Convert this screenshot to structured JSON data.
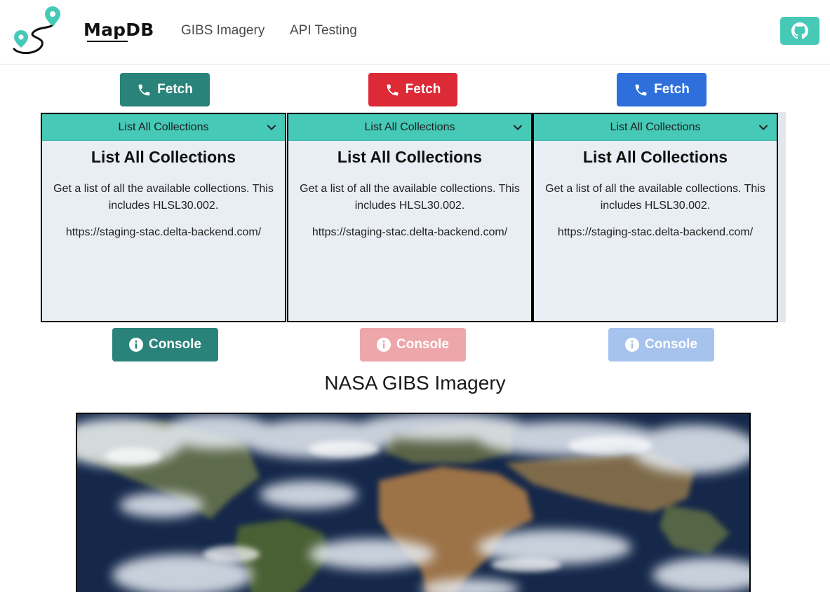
{
  "header": {
    "brand": "MapDB",
    "nav": [
      "GIBS Imagery",
      "API Testing"
    ],
    "github_icon": "github-icon",
    "accent": "#46c9b7"
  },
  "fetch_buttons": [
    {
      "label": "Fetch",
      "color": "#2a837a",
      "icon": "phone-icon"
    },
    {
      "label": "Fetch",
      "color": "#dc2a36",
      "icon": "phone-icon"
    },
    {
      "label": "Fetch",
      "color": "#2f6fdc",
      "icon": "phone-icon"
    }
  ],
  "panels": [
    {
      "select": "List All Collections",
      "title": "List All Collections",
      "description": "Get a list of all the available collections. This includes HLSL30.002.",
      "url": "https://staging-stac.delta-backend.com/"
    },
    {
      "select": "List All Collections",
      "title": "List All Collections",
      "description": "Get a list of all the available collections. This includes HLSL30.002.",
      "url": "https://staging-stac.delta-backend.com/"
    },
    {
      "select": "List All Collections",
      "title": "List All Collections",
      "description": "Get a list of all the available collections. This includes HLSL30.002.",
      "url": "https://staging-stac.delta-backend.com/"
    }
  ],
  "console_buttons": [
    {
      "label": "Console",
      "color": "#2a837a",
      "icon": "info-circle-icon"
    },
    {
      "label": "Console",
      "color": "#eda7ab",
      "icon": "info-circle-icon"
    },
    {
      "label": "Console",
      "color": "#a5c3ed",
      "icon": "info-circle-icon"
    }
  ],
  "imagery": {
    "title": "NASA GIBS Imagery"
  }
}
